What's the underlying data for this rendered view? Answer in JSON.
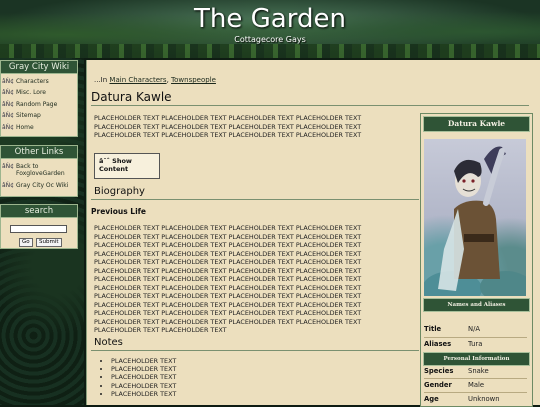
{
  "header": {
    "title": "The Garden",
    "subtitle": "Cottagecore Gays"
  },
  "sidebar": {
    "wiki_title": "Gray City Wiki",
    "wiki_items": [
      {
        "label": "Characters"
      },
      {
        "label": "Misc. Lore"
      },
      {
        "label": "Random Page"
      },
      {
        "label": "Sitemap"
      },
      {
        "label": "Home"
      }
    ],
    "links_title": "Other Links",
    "link_items": [
      {
        "label": "Back to FoxgloveGarden"
      },
      {
        "label": "Gray City Oc Wiki"
      }
    ],
    "search_title": "search",
    "search_go": "Go",
    "search_submit": "Submit",
    "item_icon": "âŃ¢"
  },
  "main": {
    "breadcrumb_prefix": "...In",
    "breadcrumb_link1": "Main Characters",
    "breadcrumb_sep": ",",
    "breadcrumb_link2": "Townspeople",
    "page_title": "Datura Kawle",
    "intro_lines": [
      "PLACEHOLDER TEXT PLACEHOLDER TEXT PLACEHOLDER TEXT PLACEHOLDER TEXT",
      "PLACEHOLDER TEXT PLACEHOLDER TEXT PLACEHOLDER TEXT PLACEHOLDER TEXT",
      "PLACEHOLDER TEXT PLACEHOLDER TEXT PLACEHOLDER TEXT PLACEHOLDER TEXT"
    ],
    "show_content_label": "â¯ˆ Show Content",
    "biography_heading": "Biography",
    "previous_life_heading": "Previous Life",
    "bio_lines": [
      "PLACEHOLDER TEXT PLACEHOLDER TEXT PLACEHOLDER TEXT PLACEHOLDER TEXT",
      "PLACEHOLDER TEXT PLACEHOLDER TEXT PLACEHOLDER TEXT PLACEHOLDER TEXT",
      "PLACEHOLDER TEXT PLACEHOLDER TEXT PLACEHOLDER TEXT PLACEHOLDER TEXT",
      "PLACEHOLDER TEXT PLACEHOLDER TEXT PLACEHOLDER TEXT PLACEHOLDER TEXT",
      "PLACEHOLDER TEXT PLACEHOLDER TEXT PLACEHOLDER TEXT PLACEHOLDER TEXT",
      "PLACEHOLDER TEXT PLACEHOLDER TEXT PLACEHOLDER TEXT PLACEHOLDER TEXT",
      "PLACEHOLDER TEXT PLACEHOLDER TEXT PLACEHOLDER TEXT PLACEHOLDER TEXT",
      "PLACEHOLDER TEXT PLACEHOLDER TEXT PLACEHOLDER TEXT PLACEHOLDER TEXT",
      "PLACEHOLDER TEXT PLACEHOLDER TEXT PLACEHOLDER TEXT PLACEHOLDER TEXT",
      "PLACEHOLDER TEXT PLACEHOLDER TEXT PLACEHOLDER TEXT PLACEHOLDER TEXT",
      "PLACEHOLDER TEXT PLACEHOLDER TEXT PLACEHOLDER TEXT PLACEHOLDER TEXT",
      "PLACEHOLDER TEXT PLACEHOLDER TEXT PLACEHOLDER TEXT PLACEHOLDER TEXT",
      "PLACEHOLDER TEXT PLACEHOLDER TEXT"
    ],
    "notes_heading": "Notes",
    "notes_items": [
      "PLACEHOLDER TEXT",
      "PLACEHOLDER TEXT",
      "PLACEHOLDER TEXT",
      "PLACEHOLDER TEXT",
      "PLACEHOLDER TEXT"
    ]
  },
  "infobox": {
    "name": "Datura Kawle",
    "names_header": "Names and Aliases",
    "title_label": "Title",
    "title_value": "N/A",
    "aliases_label": "Aliases",
    "aliases_value": "Tura",
    "personal_header": "Personal Information",
    "species_label": "Species",
    "species_value": "Snake",
    "gender_label": "Gender",
    "gender_value": "Male",
    "age_label": "Age",
    "age_value": "Unknown"
  }
}
